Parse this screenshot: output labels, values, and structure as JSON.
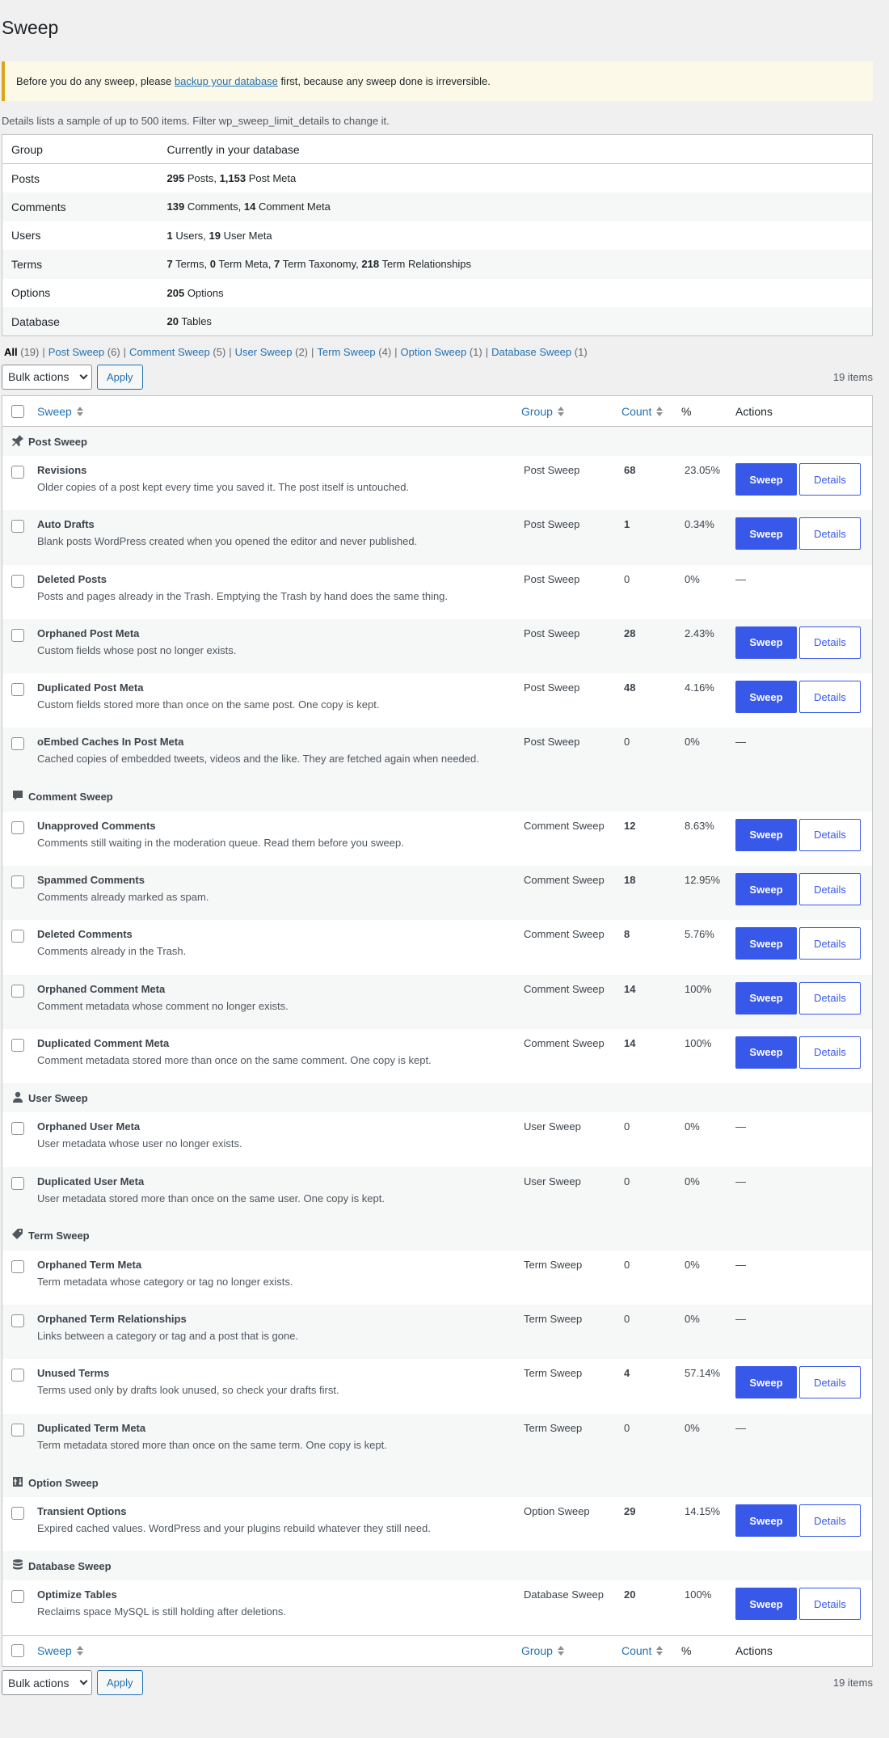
{
  "page": {
    "title": "Sweep",
    "notice": {
      "before": "Before you do any sweep, please ",
      "link": "backup your database",
      "after": " first, because any sweep done is irreversible."
    },
    "detail_note": "Details lists a sample of up to 500 items. Filter wp_sweep_limit_details to change it."
  },
  "summary": {
    "headers": [
      "Group",
      "Currently in your database"
    ],
    "rows": [
      {
        "group": "Posts",
        "parts": [
          {
            "n": "295",
            "t": " Posts, "
          },
          {
            "n": "1,153",
            "t": " Post Meta"
          }
        ]
      },
      {
        "group": "Comments",
        "parts": [
          {
            "n": "139",
            "t": " Comments, "
          },
          {
            "n": "14",
            "t": " Comment Meta"
          }
        ]
      },
      {
        "group": "Users",
        "parts": [
          {
            "n": "1",
            "t": " Users, "
          },
          {
            "n": "19",
            "t": " User Meta"
          }
        ]
      },
      {
        "group": "Terms",
        "parts": [
          {
            "n": "7",
            "t": " Terms, "
          },
          {
            "n": "0",
            "t": " Term Meta, "
          },
          {
            "n": "7",
            "t": " Term Taxonomy, "
          },
          {
            "n": "218",
            "t": " Term Relationships"
          }
        ]
      },
      {
        "group": "Options",
        "parts": [
          {
            "n": "205",
            "t": " Options"
          }
        ]
      },
      {
        "group": "Database",
        "parts": [
          {
            "n": "20",
            "t": " Tables"
          }
        ]
      }
    ]
  },
  "filters": [
    {
      "label": "All",
      "count": "(19)",
      "current": true
    },
    {
      "label": "Post Sweep",
      "count": "(6)"
    },
    {
      "label": "Comment Sweep",
      "count": "(5)"
    },
    {
      "label": "User Sweep",
      "count": "(2)"
    },
    {
      "label": "Term Sweep",
      "count": "(4)"
    },
    {
      "label": "Option Sweep",
      "count": "(1)"
    },
    {
      "label": "Database Sweep",
      "count": "(1)"
    }
  ],
  "tablenav": {
    "bulk_label": "Bulk actions",
    "apply_label": "Apply",
    "items_count": "19 items"
  },
  "columns": {
    "sweep": "Sweep",
    "group": "Group",
    "count": "Count",
    "pct": "%",
    "actions": "Actions"
  },
  "buttons": {
    "sweep": "Sweep",
    "details": "Details",
    "empty": "—"
  },
  "groups": [
    {
      "name": "Post Sweep",
      "icon": "pin-icon",
      "items": [
        {
          "title": "Revisions",
          "desc": "Older copies of a post kept every time you saved it. The post itself is untouched.",
          "group": "Post Sweep",
          "count": "68",
          "pct": "23.05%",
          "actionable": true
        },
        {
          "title": "Auto Drafts",
          "desc": "Blank posts WordPress created when you opened the editor and never published.",
          "group": "Post Sweep",
          "count": "1",
          "pct": "0.34%",
          "actionable": true
        },
        {
          "title": "Deleted Posts",
          "desc": "Posts and pages already in the Trash. Emptying the Trash by hand does the same thing.",
          "group": "Post Sweep",
          "count": "0",
          "pct": "0%",
          "actionable": false
        },
        {
          "title": "Orphaned Post Meta",
          "desc": "Custom fields whose post no longer exists.",
          "group": "Post Sweep",
          "count": "28",
          "pct": "2.43%",
          "actionable": true
        },
        {
          "title": "Duplicated Post Meta",
          "desc": "Custom fields stored more than once on the same post. One copy is kept.",
          "group": "Post Sweep",
          "count": "48",
          "pct": "4.16%",
          "actionable": true
        },
        {
          "title": "oEmbed Caches In Post Meta",
          "desc": "Cached copies of embedded tweets, videos and the like. They are fetched again when needed.",
          "group": "Post Sweep",
          "count": "0",
          "pct": "0%",
          "actionable": false
        }
      ]
    },
    {
      "name": "Comment Sweep",
      "icon": "comment-icon",
      "items": [
        {
          "title": "Unapproved Comments",
          "desc": "Comments still waiting in the moderation queue. Read them before you sweep.",
          "group": "Comment Sweep",
          "count": "12",
          "pct": "8.63%",
          "actionable": true
        },
        {
          "title": "Spammed Comments",
          "desc": "Comments already marked as spam.",
          "group": "Comment Sweep",
          "count": "18",
          "pct": "12.95%",
          "actionable": true
        },
        {
          "title": "Deleted Comments",
          "desc": "Comments already in the Trash.",
          "group": "Comment Sweep",
          "count": "8",
          "pct": "5.76%",
          "actionable": true
        },
        {
          "title": "Orphaned Comment Meta",
          "desc": "Comment metadata whose comment no longer exists.",
          "group": "Comment Sweep",
          "count": "14",
          "pct": "100%",
          "actionable": true
        },
        {
          "title": "Duplicated Comment Meta",
          "desc": "Comment metadata stored more than once on the same comment. One copy is kept.",
          "group": "Comment Sweep",
          "count": "14",
          "pct": "100%",
          "actionable": true
        }
      ]
    },
    {
      "name": "User Sweep",
      "icon": "user-icon",
      "items": [
        {
          "title": "Orphaned User Meta",
          "desc": "User metadata whose user no longer exists.",
          "group": "User Sweep",
          "count": "0",
          "pct": "0%",
          "actionable": false
        },
        {
          "title": "Duplicated User Meta",
          "desc": "User metadata stored more than once on the same user. One copy is kept.",
          "group": "User Sweep",
          "count": "0",
          "pct": "0%",
          "actionable": false
        }
      ]
    },
    {
      "name": "Term Sweep",
      "icon": "tag-icon",
      "items": [
        {
          "title": "Orphaned Term Meta",
          "desc": "Term metadata whose category or tag no longer exists.",
          "group": "Term Sweep",
          "count": "0",
          "pct": "0%",
          "actionable": false
        },
        {
          "title": "Orphaned Term Relationships",
          "desc": "Links between a category or tag and a post that is gone.",
          "group": "Term Sweep",
          "count": "0",
          "pct": "0%",
          "actionable": false
        },
        {
          "title": "Unused Terms",
          "desc": "Terms used only by drafts look unused, so check your drafts first.",
          "group": "Term Sweep",
          "count": "4",
          "pct": "57.14%",
          "actionable": true
        },
        {
          "title": "Duplicated Term Meta",
          "desc": "Term metadata stored more than once on the same term. One copy is kept.",
          "group": "Term Sweep",
          "count": "0",
          "pct": "0%",
          "actionable": false
        }
      ]
    },
    {
      "name": "Option Sweep",
      "icon": "settings-icon",
      "items": [
        {
          "title": "Transient Options",
          "desc": "Expired cached values. WordPress and your plugins rebuild whatever they still need.",
          "group": "Option Sweep",
          "count": "29",
          "pct": "14.15%",
          "actionable": true
        }
      ]
    },
    {
      "name": "Database Sweep",
      "icon": "database-icon",
      "items": [
        {
          "title": "Optimize Tables",
          "desc": "Reclaims space MySQL is still holding after deletions.",
          "group": "Database Sweep",
          "count": "20",
          "pct": "100%",
          "actionable": true
        }
      ]
    }
  ]
}
